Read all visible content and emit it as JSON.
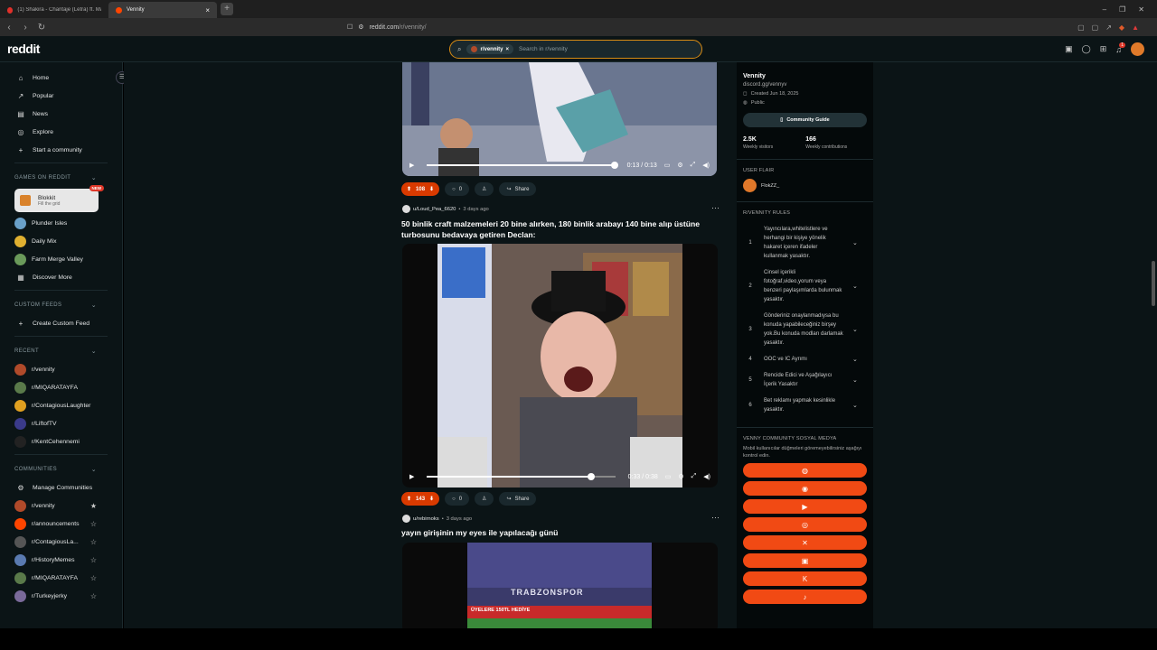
{
  "browser": {
    "tabs": [
      {
        "title": "(1) Shakira - Chantaje (Letra) ft. Mal...",
        "active": false
      },
      {
        "title": "Vennity",
        "active": true
      }
    ],
    "url_host": "reddit.com",
    "url_path": "/r/vennity/"
  },
  "header": {
    "logo": "reddit",
    "search_chip": "r/vennity",
    "search_placeholder": "Search in r/vennity",
    "notif_count": "1"
  },
  "sidebar": {
    "main_items": [
      {
        "icon": "home-icon",
        "glyph": "⌂",
        "label": "Home"
      },
      {
        "icon": "popular-icon",
        "glyph": "↗",
        "label": "Popular"
      },
      {
        "icon": "news-icon",
        "glyph": "▤",
        "label": "News"
      },
      {
        "icon": "explore-icon",
        "glyph": "◎",
        "label": "Explore"
      },
      {
        "icon": "plus-icon",
        "glyph": "+",
        "label": "Start a community"
      }
    ],
    "games_header": "GAMES ON REDDIT",
    "featured_game": {
      "title": "Blokkit",
      "subtitle": "Fill the grid",
      "badge": "NEW"
    },
    "games": [
      {
        "label": "Plunder Isles",
        "color": "#6aa0c8"
      },
      {
        "label": "Daily Mix",
        "color": "#e0b030"
      },
      {
        "label": "Farm Merge Valley",
        "color": "#6a9a5a"
      },
      {
        "label": "Discover More",
        "color": ""
      }
    ],
    "custom_header": "CUSTOM FEEDS",
    "create_feed": "Create Custom Feed",
    "recent_header": "RECENT",
    "recent": [
      {
        "label": "r/vennity",
        "color": "#b04a2a"
      },
      {
        "label": "r/MIQARATAYFA",
        "color": "#5a7a4a"
      },
      {
        "label": "r/ContagiousLaughter",
        "color": "#e0a020"
      },
      {
        "label": "r/LiftofTV",
        "color": "#3a3a8a"
      },
      {
        "label": "r/KentCehennemi",
        "color": "#222222"
      }
    ],
    "communities_header": "COMMUNITIES",
    "manage": "Manage Communities",
    "communities": [
      {
        "label": "r/vennity",
        "color": "#b04a2a",
        "starred": true
      },
      {
        "label": "r/announcements",
        "color": "#ff4500",
        "starred": false
      },
      {
        "label": "r/ContagiousLa...",
        "color": "#555555",
        "starred": false
      },
      {
        "label": "r/HistoryMemes",
        "color": "#5a7ab0",
        "starred": false
      },
      {
        "label": "r/MIQARATAYFA",
        "color": "#5a7a4a",
        "starred": false
      },
      {
        "label": "r/Turkeyjerky",
        "color": "#7a6a9a",
        "starred": false
      }
    ]
  },
  "feed": {
    "post1": {
      "time": "0:13 / 0:13",
      "progress": 1.0,
      "votes": "108",
      "comments": "0",
      "share": "Share"
    },
    "post2": {
      "user": "u/Loud_Pea_6620",
      "age": "3 days ago",
      "title": "50 binlik craft malzemeleri 20 bine alırken, 180 binlik arabayı 140 bine alıp üstüne turbosunu bedavaya getiren Declan:",
      "time": "0:33 / 0:38",
      "progress": 0.87,
      "votes": "143",
      "comments": "0",
      "share": "Share"
    },
    "post3": {
      "user": "u/rebirnoks",
      "age": "3 days ago",
      "title": "yayın girişinin my eyes ile yapılacağı günü",
      "banner_text": "TRABZONSPOR",
      "ad_text": "ÜYELERE 150TL HEDİYE"
    }
  },
  "right": {
    "name": "Vennity",
    "link": "discord.gg/vennyv",
    "created": "Created Jun 18, 2025",
    "visibility": "Public",
    "guide": "Community Guide",
    "visitors": "2.5K",
    "visitors_label": "Weekly visitors",
    "contrib": "166",
    "contrib_label": "Weekly contributions",
    "flair_header": "USER FLAIR",
    "flair_user": "FlokZZ_",
    "rules_header": "R/VENNITY RULES",
    "rules": [
      {
        "n": "1",
        "text": "Yayıncılara,whitelistlere ve herhangi bir kişiye yönelik hakaret içeren ifadeler kullanmak yasaktır."
      },
      {
        "n": "2",
        "text": "Cinsel içerikli fotoğraf,video,yorum veya benzeri paylaşımlarda bulunmak yasaktır."
      },
      {
        "n": "3",
        "text": "Gönderiniz onaylanmadıysa bu konuda yapabileceğiniz birşey yok.Bu konuda modları darlamak yasaktır."
      },
      {
        "n": "4",
        "text": "OOC ve IC Ayrımı"
      },
      {
        "n": "5",
        "text": "Rencide Edici ve Aşağılayıcı İçerik Yasaktır"
      },
      {
        "n": "6",
        "text": "Bet reklamı yapmak kesinlikle yasaktır."
      }
    ],
    "social_header": "VENNY COMMUNITY SOSYAL MEDYA",
    "social_note": "Mobil kullanıcılar düğmeleri göremeyebilirsiniz aşağıyı kontrol edin.",
    "social_buttons": [
      {
        "icon": "globe-icon",
        "glyph": "◍"
      },
      {
        "icon": "discord-icon",
        "glyph": "◉"
      },
      {
        "icon": "youtube-icon",
        "glyph": "▶"
      },
      {
        "icon": "instagram-icon",
        "glyph": "◎"
      },
      {
        "icon": "x-icon",
        "glyph": "✕"
      },
      {
        "icon": "twitch-icon",
        "glyph": "▣"
      },
      {
        "icon": "kick-icon",
        "glyph": "K"
      },
      {
        "icon": "tiktok-icon",
        "glyph": "♪"
      }
    ]
  }
}
